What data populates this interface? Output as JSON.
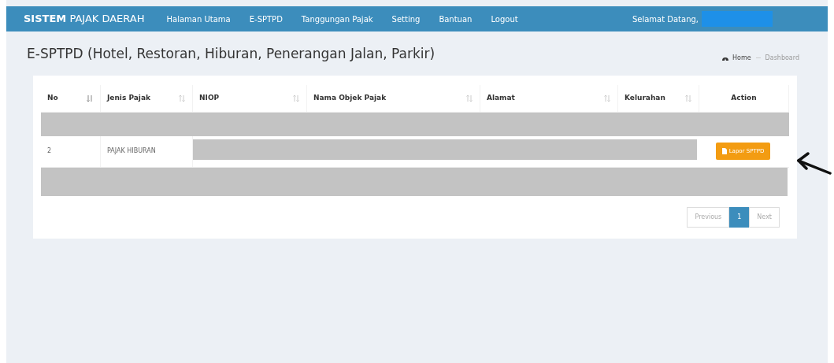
{
  "navbar": {
    "brand_bold": "SISTEM",
    "brand_rest": "PAJAK DAERAH",
    "menu": [
      "Halaman Utama",
      "E-SPTPD",
      "Tanggungan Pajak",
      "Setting",
      "Bantuan",
      "Logout"
    ],
    "welcome": "Selamat Datang,"
  },
  "page_title": "E-SPTPD (Hotel, Restoran, Hiburan, Penerangan Jalan, Parkir)",
  "breadcrumb": [
    {
      "label": "Home",
      "kind": "home"
    },
    {
      "label": "Dashboard",
      "kind": "current"
    }
  ],
  "table": {
    "columns": [
      {
        "label": "No",
        "kind": "sorted"
      },
      {
        "label": "Jenis Pajak",
        "kind": "sortable"
      },
      {
        "label": "NIOP",
        "kind": "sortable"
      },
      {
        "label": "Nama Objek Pajak",
        "kind": "sortable"
      },
      {
        "label": "Alamat",
        "kind": "sortable"
      },
      {
        "label": "Kelurahan",
        "kind": "sortable"
      },
      {
        "label": "Action",
        "kind": "plain"
      }
    ],
    "rows": [
      {
        "kind": "redacted"
      },
      {
        "kind": "data",
        "no": "2",
        "jenis_pajak": "PAJAK HIBURAN",
        "action": "Lapor SPTPD"
      },
      {
        "kind": "redacted"
      }
    ]
  },
  "pagination": [
    {
      "label": "Previous",
      "selected": false
    },
    {
      "label": "1",
      "selected": true
    },
    {
      "label": "Next",
      "selected": false
    }
  ]
}
